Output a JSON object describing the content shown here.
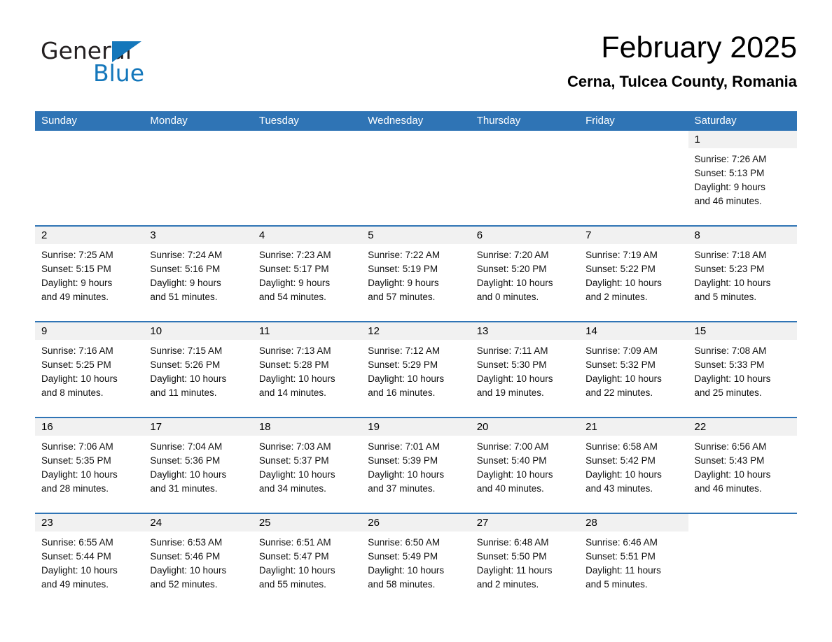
{
  "brand": {
    "name_part1": "General",
    "name_part2": "Blue",
    "accent_color": "#1477bb"
  },
  "header": {
    "month_title": "February 2025",
    "location": "Cerna, Tulcea County, Romania"
  },
  "calendar": {
    "header_color": "#2f74b5",
    "weekdays": [
      "Sunday",
      "Monday",
      "Tuesday",
      "Wednesday",
      "Thursday",
      "Friday",
      "Saturday"
    ],
    "weeks": [
      [
        {
          "day": "",
          "blank": true,
          "lines": []
        },
        {
          "day": "",
          "blank": true,
          "lines": []
        },
        {
          "day": "",
          "blank": true,
          "lines": []
        },
        {
          "day": "",
          "blank": true,
          "lines": []
        },
        {
          "day": "",
          "blank": true,
          "lines": []
        },
        {
          "day": "",
          "blank": true,
          "lines": []
        },
        {
          "day": "1",
          "lines": [
            "Sunrise: 7:26 AM",
            "Sunset: 5:13 PM",
            "Daylight: 9 hours",
            "and 46 minutes."
          ]
        }
      ],
      [
        {
          "day": "2",
          "lines": [
            "Sunrise: 7:25 AM",
            "Sunset: 5:15 PM",
            "Daylight: 9 hours",
            "and 49 minutes."
          ]
        },
        {
          "day": "3",
          "lines": [
            "Sunrise: 7:24 AM",
            "Sunset: 5:16 PM",
            "Daylight: 9 hours",
            "and 51 minutes."
          ]
        },
        {
          "day": "4",
          "lines": [
            "Sunrise: 7:23 AM",
            "Sunset: 5:17 PM",
            "Daylight: 9 hours",
            "and 54 minutes."
          ]
        },
        {
          "day": "5",
          "lines": [
            "Sunrise: 7:22 AM",
            "Sunset: 5:19 PM",
            "Daylight: 9 hours",
            "and 57 minutes."
          ]
        },
        {
          "day": "6",
          "lines": [
            "Sunrise: 7:20 AM",
            "Sunset: 5:20 PM",
            "Daylight: 10 hours",
            "and 0 minutes."
          ]
        },
        {
          "day": "7",
          "lines": [
            "Sunrise: 7:19 AM",
            "Sunset: 5:22 PM",
            "Daylight: 10 hours",
            "and 2 minutes."
          ]
        },
        {
          "day": "8",
          "lines": [
            "Sunrise: 7:18 AM",
            "Sunset: 5:23 PM",
            "Daylight: 10 hours",
            "and 5 minutes."
          ]
        }
      ],
      [
        {
          "day": "9",
          "lines": [
            "Sunrise: 7:16 AM",
            "Sunset: 5:25 PM",
            "Daylight: 10 hours",
            "and 8 minutes."
          ]
        },
        {
          "day": "10",
          "lines": [
            "Sunrise: 7:15 AM",
            "Sunset: 5:26 PM",
            "Daylight: 10 hours",
            "and 11 minutes."
          ]
        },
        {
          "day": "11",
          "lines": [
            "Sunrise: 7:13 AM",
            "Sunset: 5:28 PM",
            "Daylight: 10 hours",
            "and 14 minutes."
          ]
        },
        {
          "day": "12",
          "lines": [
            "Sunrise: 7:12 AM",
            "Sunset: 5:29 PM",
            "Daylight: 10 hours",
            "and 16 minutes."
          ]
        },
        {
          "day": "13",
          "lines": [
            "Sunrise: 7:11 AM",
            "Sunset: 5:30 PM",
            "Daylight: 10 hours",
            "and 19 minutes."
          ]
        },
        {
          "day": "14",
          "lines": [
            "Sunrise: 7:09 AM",
            "Sunset: 5:32 PM",
            "Daylight: 10 hours",
            "and 22 minutes."
          ]
        },
        {
          "day": "15",
          "lines": [
            "Sunrise: 7:08 AM",
            "Sunset: 5:33 PM",
            "Daylight: 10 hours",
            "and 25 minutes."
          ]
        }
      ],
      [
        {
          "day": "16",
          "lines": [
            "Sunrise: 7:06 AM",
            "Sunset: 5:35 PM",
            "Daylight: 10 hours",
            "and 28 minutes."
          ]
        },
        {
          "day": "17",
          "lines": [
            "Sunrise: 7:04 AM",
            "Sunset: 5:36 PM",
            "Daylight: 10 hours",
            "and 31 minutes."
          ]
        },
        {
          "day": "18",
          "lines": [
            "Sunrise: 7:03 AM",
            "Sunset: 5:37 PM",
            "Daylight: 10 hours",
            "and 34 minutes."
          ]
        },
        {
          "day": "19",
          "lines": [
            "Sunrise: 7:01 AM",
            "Sunset: 5:39 PM",
            "Daylight: 10 hours",
            "and 37 minutes."
          ]
        },
        {
          "day": "20",
          "lines": [
            "Sunrise: 7:00 AM",
            "Sunset: 5:40 PM",
            "Daylight: 10 hours",
            "and 40 minutes."
          ]
        },
        {
          "day": "21",
          "lines": [
            "Sunrise: 6:58 AM",
            "Sunset: 5:42 PM",
            "Daylight: 10 hours",
            "and 43 minutes."
          ]
        },
        {
          "day": "22",
          "lines": [
            "Sunrise: 6:56 AM",
            "Sunset: 5:43 PM",
            "Daylight: 10 hours",
            "and 46 minutes."
          ]
        }
      ],
      [
        {
          "day": "23",
          "lines": [
            "Sunrise: 6:55 AM",
            "Sunset: 5:44 PM",
            "Daylight: 10 hours",
            "and 49 minutes."
          ]
        },
        {
          "day": "24",
          "lines": [
            "Sunrise: 6:53 AM",
            "Sunset: 5:46 PM",
            "Daylight: 10 hours",
            "and 52 minutes."
          ]
        },
        {
          "day": "25",
          "lines": [
            "Sunrise: 6:51 AM",
            "Sunset: 5:47 PM",
            "Daylight: 10 hours",
            "and 55 minutes."
          ]
        },
        {
          "day": "26",
          "lines": [
            "Sunrise: 6:50 AM",
            "Sunset: 5:49 PM",
            "Daylight: 10 hours",
            "and 58 minutes."
          ]
        },
        {
          "day": "27",
          "lines": [
            "Sunrise: 6:48 AM",
            "Sunset: 5:50 PM",
            "Daylight: 11 hours",
            "and 2 minutes."
          ]
        },
        {
          "day": "28",
          "lines": [
            "Sunrise: 6:46 AM",
            "Sunset: 5:51 PM",
            "Daylight: 11 hours",
            "and 5 minutes."
          ]
        },
        {
          "day": "",
          "blank": true,
          "lines": []
        }
      ]
    ]
  }
}
